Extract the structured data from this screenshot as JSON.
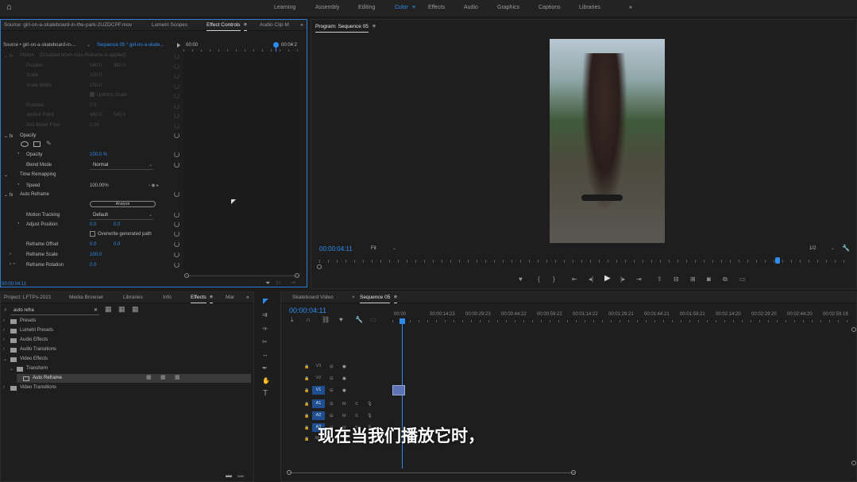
{
  "workspaces": [
    "Learning",
    "Assembly",
    "Editing",
    "Color",
    "Effects",
    "Audio",
    "Graphics",
    "Captions",
    "Libraries"
  ],
  "workspace_active": "Color",
  "source_panel": {
    "tabs": [
      "Source: girl-on-a-skateboard-in-the-park-2UZDCPF.mov",
      "Lumetri Scopes",
      "Effect Controls",
      "Audio Clip M"
    ],
    "source_label": "Source • girl-on-a-skateboard-in-...",
    "sequence_label": "Sequence 05 * girl-on-a-skate...",
    "ruler_start": "00:00",
    "ruler_end": "00:04:2",
    "motion_label": "Motion",
    "motion_note": "(Disabled when Auto Reframe is applied)",
    "position_label": "Position",
    "position_x": "540.0",
    "position_y": "960.0",
    "scale_label": "Scale",
    "scale_value": "100.0",
    "scale_width_label": "Scale Width",
    "scale_width_value": "100.0",
    "uniform_scale_label": "Uniform Scale",
    "rotation_label": "Rotation",
    "rotation_value": "0.0",
    "anchor_label": "Anchor Point",
    "anchor_x": "960.0",
    "anchor_y": "540.0",
    "antiflicker_label": "Anti-flicker Filter",
    "antiflicker_value": "0.00",
    "opacity_group": "Opacity",
    "opacity_label": "Opacity",
    "opacity_value": "100.0 %",
    "blend_label": "Blend Mode",
    "blend_value": "Normal",
    "time_remap_label": "Time Remapping",
    "speed_label": "Speed",
    "speed_value": "100.00%",
    "auto_reframe_label": "Auto Reframe",
    "analyze_label": "Analyze",
    "motion_tracking_label": "Motion Tracking",
    "motion_tracking_value": "Default",
    "adjust_position_label": "Adjust Position",
    "adjust_x": "0.0",
    "adjust_y": "0.0",
    "override_label": "Overwrite generated path",
    "reframe_offset_label": "Reframe Offset",
    "offset_x": "0.0",
    "offset_y": "0.0",
    "reframe_scale_label": "Reframe Scale",
    "reframe_scale_value": "100.0",
    "reframe_rotation_label": "Reframe Rotation",
    "reframe_rotation_value": "0.0",
    "timecode": "00:00:04:11"
  },
  "program_panel": {
    "title": "Program: Sequence 05",
    "timecode": "00:00:04:11",
    "fit_label": "Fit",
    "resolution": "1/2"
  },
  "project_panel": {
    "tabs": [
      "Project: LFTPs-2021",
      "Media Browser",
      "Libraries",
      "Info",
      "Effects",
      "Mar"
    ],
    "search_value": "auto refra",
    "tree": [
      {
        "label": "Presets",
        "level": 0
      },
      {
        "label": "Lumetri Presets",
        "level": 0
      },
      {
        "label": "Audio Effects",
        "level": 0
      },
      {
        "label": "Audio Transitions",
        "level": 0
      },
      {
        "label": "Video Effects",
        "level": 0
      },
      {
        "label": "Transform",
        "level": 1
      },
      {
        "label": "Auto Reframe",
        "level": 2
      },
      {
        "label": "Video Transitions",
        "level": 0
      }
    ]
  },
  "timeline_panel": {
    "tabs": [
      "Skateboard Video",
      "Sequence 05"
    ],
    "timecode": "00:00:04:11",
    "ruler": [
      "00:00",
      "00:00:14:23",
      "00:00:29:23",
      "00:00:44:22",
      "00:00:59:22",
      "00:01:14:22",
      "00:01:29:21",
      "00:01:44:21",
      "00:01:59:21",
      "00:02:14:20",
      "00:02:29:20",
      "00:02:44:20",
      "00:02:59:19"
    ],
    "tracks": [
      "V3",
      "V2",
      "V1",
      "A1",
      "A2",
      "A3",
      "Mix"
    ]
  },
  "subtitle": "现在当我们播放它时，"
}
